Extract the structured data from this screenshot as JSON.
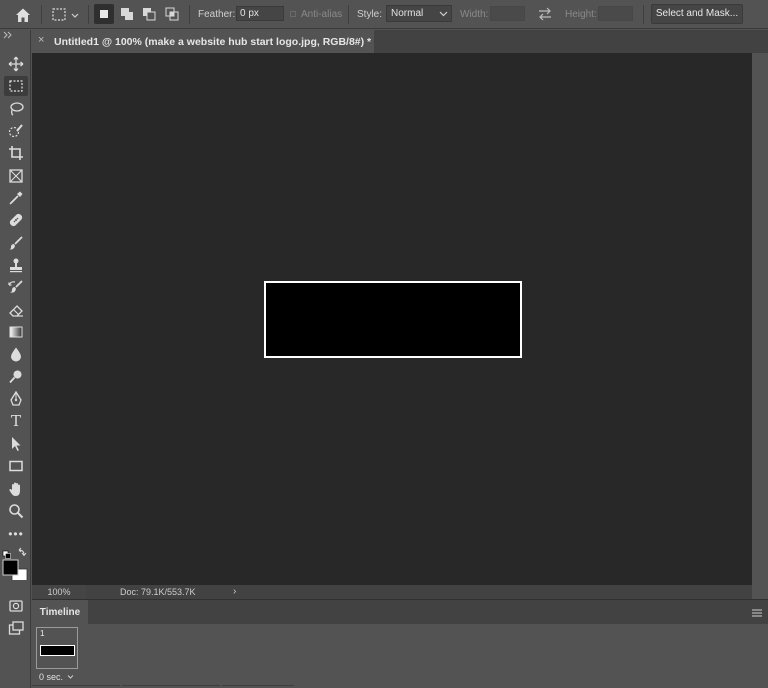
{
  "options_bar": {
    "feather_label": "Feather:",
    "feather_value": "0 px",
    "antialias_label": "Anti-alias",
    "style_label": "Style:",
    "style_value": "Normal",
    "width_label": "Width:",
    "height_label": "Height:",
    "select_mask_label": "Select and Mask..."
  },
  "document": {
    "tab_title": "Untitled1 @ 100% (make a website hub start logo.jpg, RGB/8#) *",
    "tab_close": "×"
  },
  "status_bar": {
    "zoom": "100%",
    "doc_info": "Doc: 79.1K/553.7K",
    "arrow": "›"
  },
  "timeline": {
    "tab_label": "Timeline",
    "frames": [
      {
        "number": "1",
        "delay": "0 sec."
      }
    ]
  },
  "toolbar": {
    "type_tool_glyph": "T",
    "more_tools_glyph": "•••"
  },
  "colors": {
    "ui_background": "#535353",
    "canvas_background": "#282828",
    "foreground_color": "#000000",
    "background_color": "#ffffff"
  }
}
